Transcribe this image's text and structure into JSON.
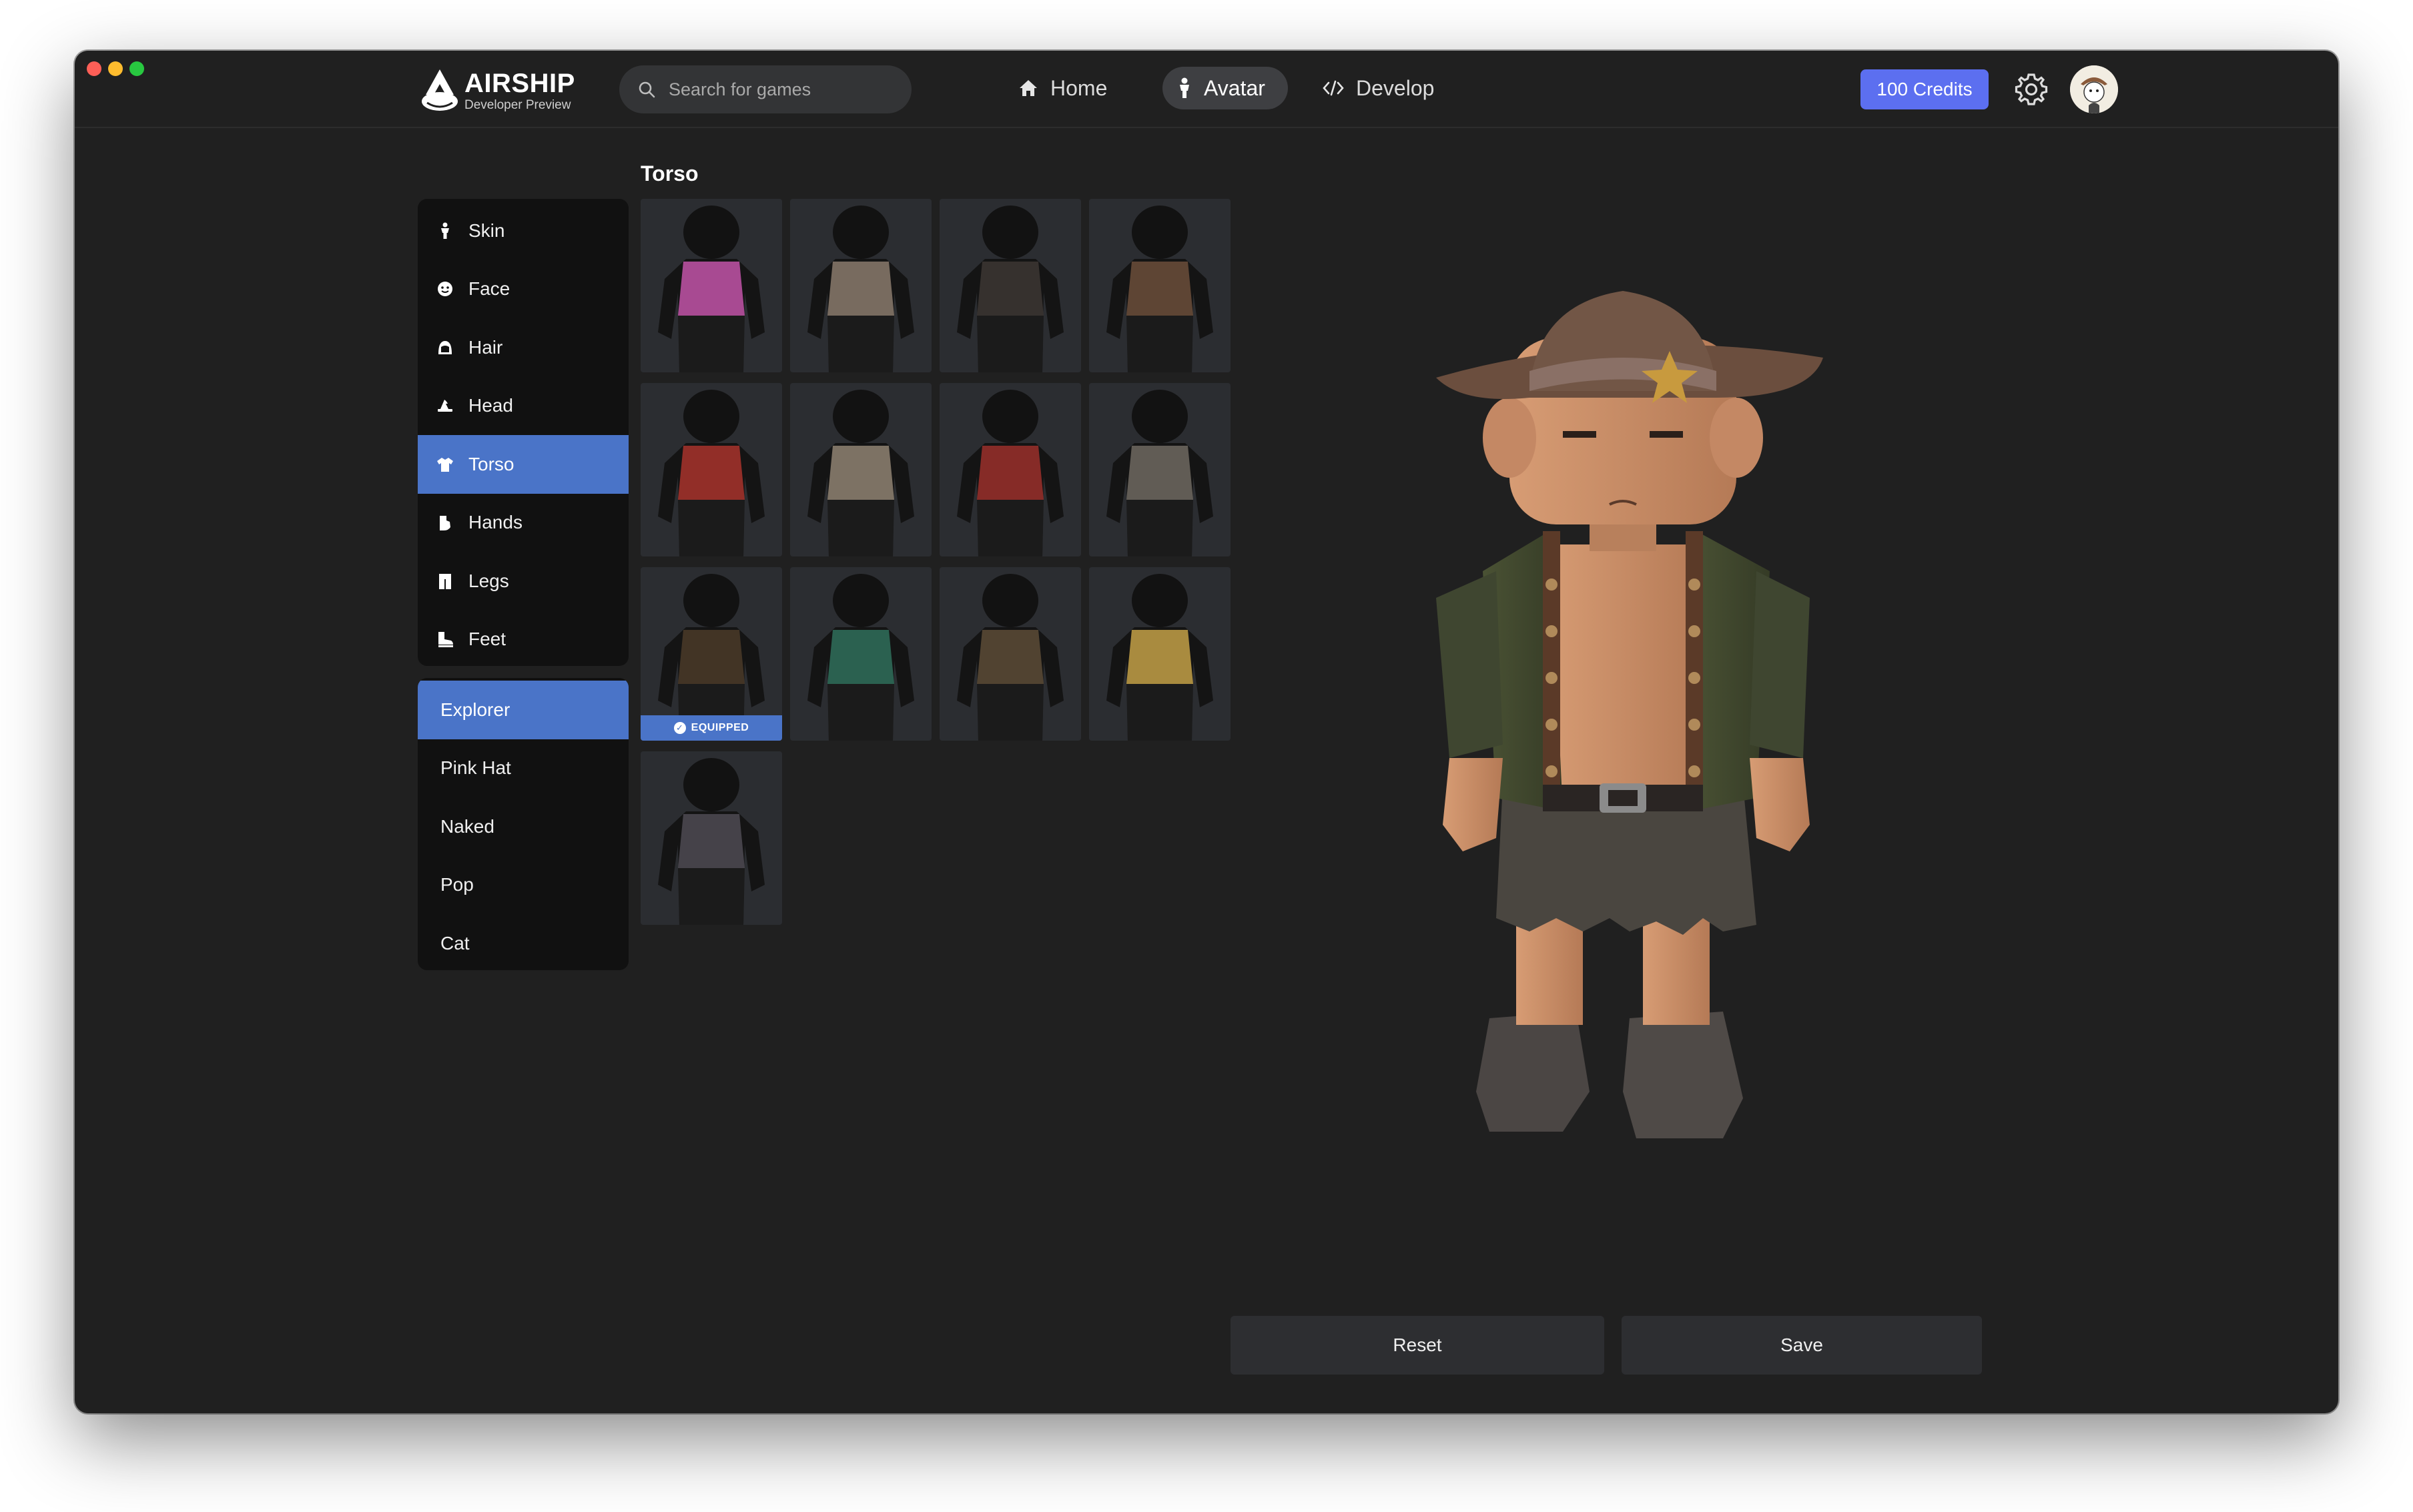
{
  "app": {
    "logo_title": "AIRSHIP",
    "logo_subtitle": "Developer Preview"
  },
  "search": {
    "placeholder": "Search for games"
  },
  "nav": [
    {
      "label": "Home",
      "icon": "home-icon",
      "active": false
    },
    {
      "label": "Avatar",
      "icon": "person-icon",
      "active": true
    },
    {
      "label": "Develop",
      "icon": "code-icon",
      "active": false
    }
  ],
  "header": {
    "credits_label": "100 Credits"
  },
  "categories": [
    {
      "label": "Skin",
      "icon": "person-icon",
      "active": false
    },
    {
      "label": "Face",
      "icon": "face-icon",
      "active": false
    },
    {
      "label": "Hair",
      "icon": "hair-icon",
      "active": false
    },
    {
      "label": "Head",
      "icon": "hat-icon",
      "active": false
    },
    {
      "label": "Torso",
      "icon": "shirt-icon",
      "active": true
    },
    {
      "label": "Hands",
      "icon": "hand-icon",
      "active": false
    },
    {
      "label": "Legs",
      "icon": "pants-icon",
      "active": false
    },
    {
      "label": "Feet",
      "icon": "boot-icon",
      "active": false
    }
  ],
  "outfits": [
    {
      "label": "Explorer",
      "active": true
    },
    {
      "label": "Pink Hat",
      "active": false
    },
    {
      "label": "Naked",
      "active": false
    },
    {
      "label": "Pop",
      "active": false
    },
    {
      "label": "Cat",
      "active": false
    }
  ],
  "section_title": "Torso",
  "torso_items": [
    {
      "color": "#c253a8",
      "equipped": false
    },
    {
      "color": "#8a7a6c",
      "equipped": false
    },
    {
      "color": "#3c3632",
      "equipped": false
    },
    {
      "color": "#6b4e3a",
      "equipped": false
    },
    {
      "color": "#a8332c",
      "equipped": false
    },
    {
      "color": "#8f8272",
      "equipped": false
    },
    {
      "color": "#9a2f2a",
      "equipped": false
    },
    {
      "color": "#6f6860",
      "equipped": false
    },
    {
      "color": "#4a3a28",
      "equipped": true
    },
    {
      "color": "#2f6e5a",
      "equipped": false
    },
    {
      "color": "#5c4b36",
      "equipped": false
    },
    {
      "color": "#c3a046",
      "equipped": false
    },
    {
      "color": "#4e4a52",
      "equipped": false
    }
  ],
  "equipped_label": "EQUIPPED",
  "actions": {
    "reset_label": "Reset",
    "save_label": "Save"
  }
}
